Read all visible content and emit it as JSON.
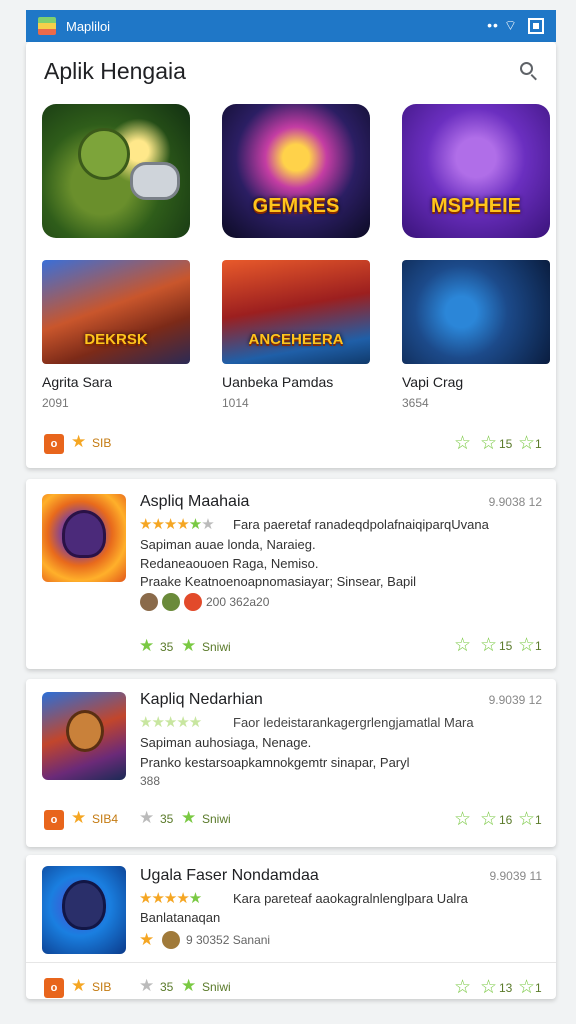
{
  "status_bar": {
    "title": "Mapliloi",
    "bg": "#1f77c7"
  },
  "header": {
    "title": "Aplik Hengaia",
    "search_icon": "search-icon"
  },
  "featured": [
    {
      "label": "GEMRES"
    },
    {
      "label": "MSPHEIE"
    }
  ],
  "tiles": [
    {
      "name": "Agrita Sara",
      "count": "2091",
      "label": "DEKRSK"
    },
    {
      "name": "Uanbeka Pamdas",
      "count": "1014",
      "label": "ANCEHEERA"
    },
    {
      "name": "Vapi Crag",
      "count": "3654",
      "label": ""
    }
  ],
  "card1_footer": {
    "left_badge": "o",
    "left_text": "SIB",
    "right_count": "15",
    "right_last": "1"
  },
  "list": [
    {
      "title": "Aspliq Maahaia",
      "date": "9.9038 12",
      "line1": "Fara paeretaf ranadeqdpolafnaiqiparqUvana",
      "line2": "Sapiman auae londa, Naraieg.",
      "line3": "Redaneaouoen Raga, Nemiso.",
      "line4": "Praake Keatnoenoapnomasiayar; Sinsear, Bapil",
      "meta": "200 362a20",
      "footer": {
        "left_count": "35",
        "left_text": "Sniwi",
        "right_count": "15",
        "right_last": "1"
      },
      "rating_color": "#f5a623"
    },
    {
      "title": "Kapliq Nedarhian",
      "date": "9.9039 12",
      "line1": "Faor ledeistarankagergrlengjamatlal Mara",
      "line2": "Sapiman auhosiaga, Nenage.",
      "line3": "Pranko kestarsoapkamnokgemtr sinapar, Paryl",
      "line4": "388",
      "footer": {
        "left_badge": "o",
        "left_text": "SIB4",
        "mid_count": "35",
        "mid_text": "Sniwi",
        "right_count": "16",
        "right_last": "1"
      },
      "rating_color": "#c8e6a0"
    },
    {
      "title": "Ugala Faser Nondamdaa",
      "date": "9.9039 11",
      "line1": "Kara pareteaf aaokagralnlenglpara Ualra",
      "line2": "Banlatanaqan",
      "meta": "9 30352 Sanani",
      "footer": {
        "left_badge": "o",
        "left_text": "SIB",
        "mid_count": "35",
        "mid_text": "Sniwi",
        "right_count": "13",
        "right_last": "1"
      },
      "rating_color": "#f5a623"
    }
  ],
  "colors": {
    "accent": "#1f77c7",
    "orange": "#e8651c",
    "green": "#7ac943",
    "star": "#f5a623"
  }
}
